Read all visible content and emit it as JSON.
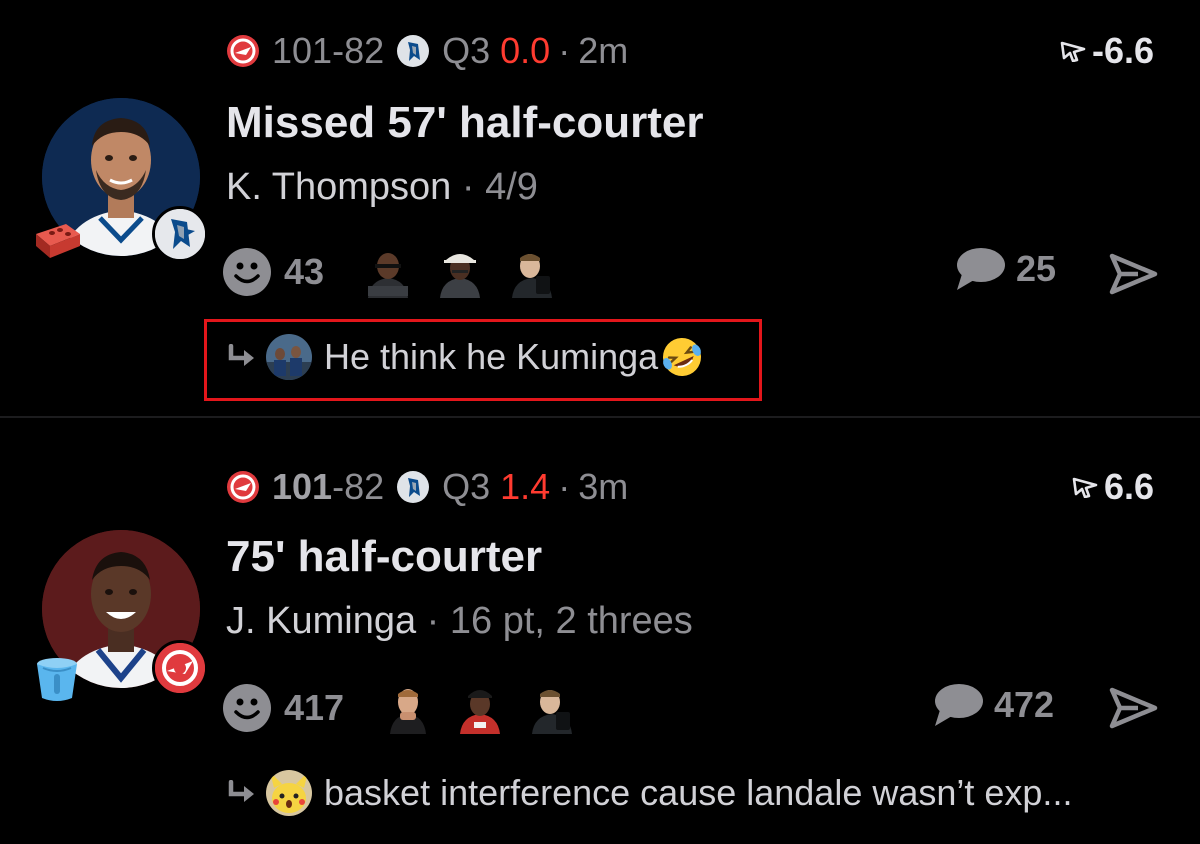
{
  "feed": {
    "posts": [
      {
        "game": {
          "home_score": "101",
          "score_sep": "-",
          "away_score": "82",
          "period": "Q3",
          "game_clock": "0.0",
          "age": "2m"
        },
        "odds": "-6.6",
        "title": "Missed 57' half-courter",
        "player": "K. Thompson",
        "stat": "4/9",
        "reaction_count": "43",
        "comment_count": "25",
        "top_reply": {
          "text": "He think he Kuminga",
          "emoji": "rolling-on-floor-laughing"
        },
        "sticker_icon": "brick-icon",
        "team_badge": "mavericks-logo"
      },
      {
        "game": {
          "home_score": "101",
          "score_sep": "-",
          "away_score": "82",
          "period": "Q3",
          "game_clock": "1.4",
          "age": "3m"
        },
        "odds": "6.6",
        "title": "75' half-courter",
        "player": "J. Kuminga",
        "stat": "16 pt, 2 threes",
        "reaction_count": "417",
        "comment_count": "472",
        "top_reply": {
          "text": "basket interference cause landale wasn’t exp..."
        },
        "sticker_icon": "bucket-icon",
        "team_badge": "hawks-logo"
      }
    ],
    "separator": "·",
    "colors": {
      "clock_red": "#ff3b30",
      "highlight_red": "#e3161b",
      "muted": "#8e8e93"
    }
  }
}
